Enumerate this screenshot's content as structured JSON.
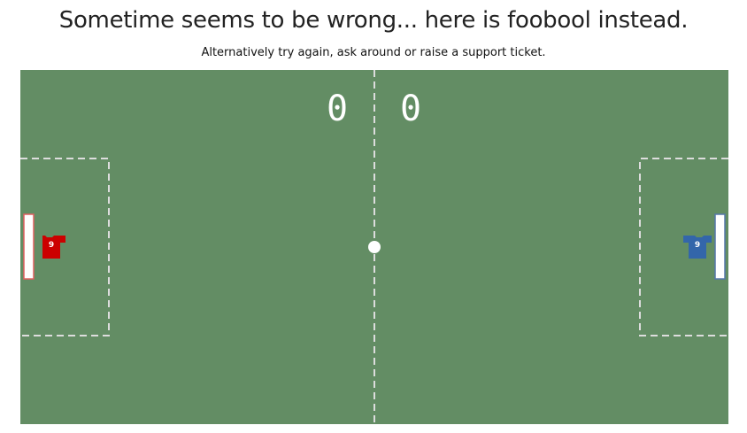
{
  "page": {
    "title": "Sometime seems to be wrong... here is foobool instead.",
    "subtitle": "Alternatively try again, ask around or raise a support ticket."
  },
  "game": {
    "score": {
      "home": "0",
      "away": "0"
    },
    "players": {
      "home": {
        "number": "9",
        "color": "#cc0000"
      },
      "away": {
        "number": "9",
        "color": "#3366aa"
      }
    },
    "colors": {
      "pitch": "#638d64",
      "lines": "#dddddd",
      "ball": "#ffffff",
      "home_goal_border": "#e06060",
      "away_goal_border": "#5577aa"
    }
  }
}
